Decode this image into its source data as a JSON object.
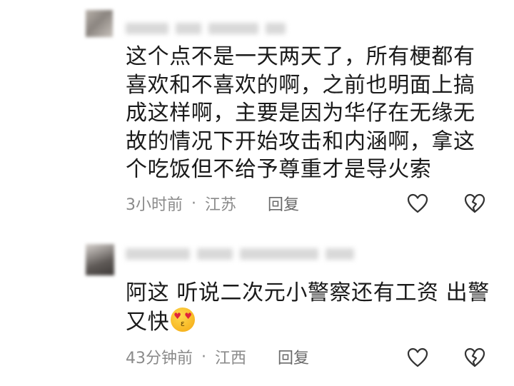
{
  "comments": [
    {
      "text": "这个点不是一天两天了，所有梗都有喜欢和不喜欢的啊，之前也明面上搞成这样啊，主要是因为华仔在无缘无故的情况下开始攻击和内涵啊，拿这个吃饭但不给予尊重才是导火索",
      "time": "3小时前",
      "separator": "·",
      "location": "江苏",
      "reply_label": "回复"
    },
    {
      "text": "阿这 听说二次元小警察还有工资 出警又快",
      "emoji": "heart-eyes-kissing-emoji",
      "time": "43分钟前",
      "separator": "·",
      "location": "江西",
      "reply_label": "回复"
    }
  ],
  "icons": {
    "like": "heart-outline-icon",
    "dislike": "broken-heart-outline-icon"
  },
  "colors": {
    "text": "#1a1a1a",
    "meta": "#8a8a8a",
    "icon": "#333333"
  }
}
